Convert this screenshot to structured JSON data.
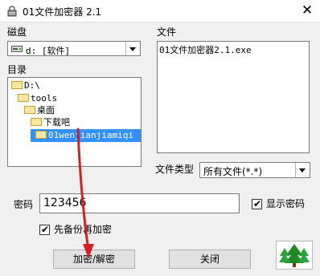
{
  "window": {
    "title": "01文件加密器 2.1",
    "close_glyph": "✕"
  },
  "drive": {
    "label": "磁盘",
    "value": "d: [软件]"
  },
  "directory": {
    "label": "目录",
    "items": [
      {
        "text": "D:\\"
      },
      {
        "text": "tools"
      },
      {
        "text": "桌面"
      },
      {
        "text": "下载吧"
      },
      {
        "text": "01wenjianjiamiqi",
        "selected": true
      }
    ]
  },
  "files": {
    "label": "文件",
    "items": [
      "01文件加密器2.1.exe"
    ]
  },
  "filetype": {
    "label": "文件类型",
    "value": "所有文件(*.*)"
  },
  "password": {
    "label": "密码",
    "value": "123456"
  },
  "show_password": {
    "label": "显示密码",
    "checked": true
  },
  "backup_first": {
    "label": "先备份再加密",
    "checked": true
  },
  "buttons": {
    "encrypt_decrypt": "加密/解密",
    "close": "关闭"
  },
  "icons": [
    "lock-icon",
    "drive-icon",
    "folder-icon",
    "close-icon",
    "dropdown-arrow-icon"
  ],
  "colors": {
    "selection": "#3390ff",
    "annotation_arrow": "#d42020"
  }
}
